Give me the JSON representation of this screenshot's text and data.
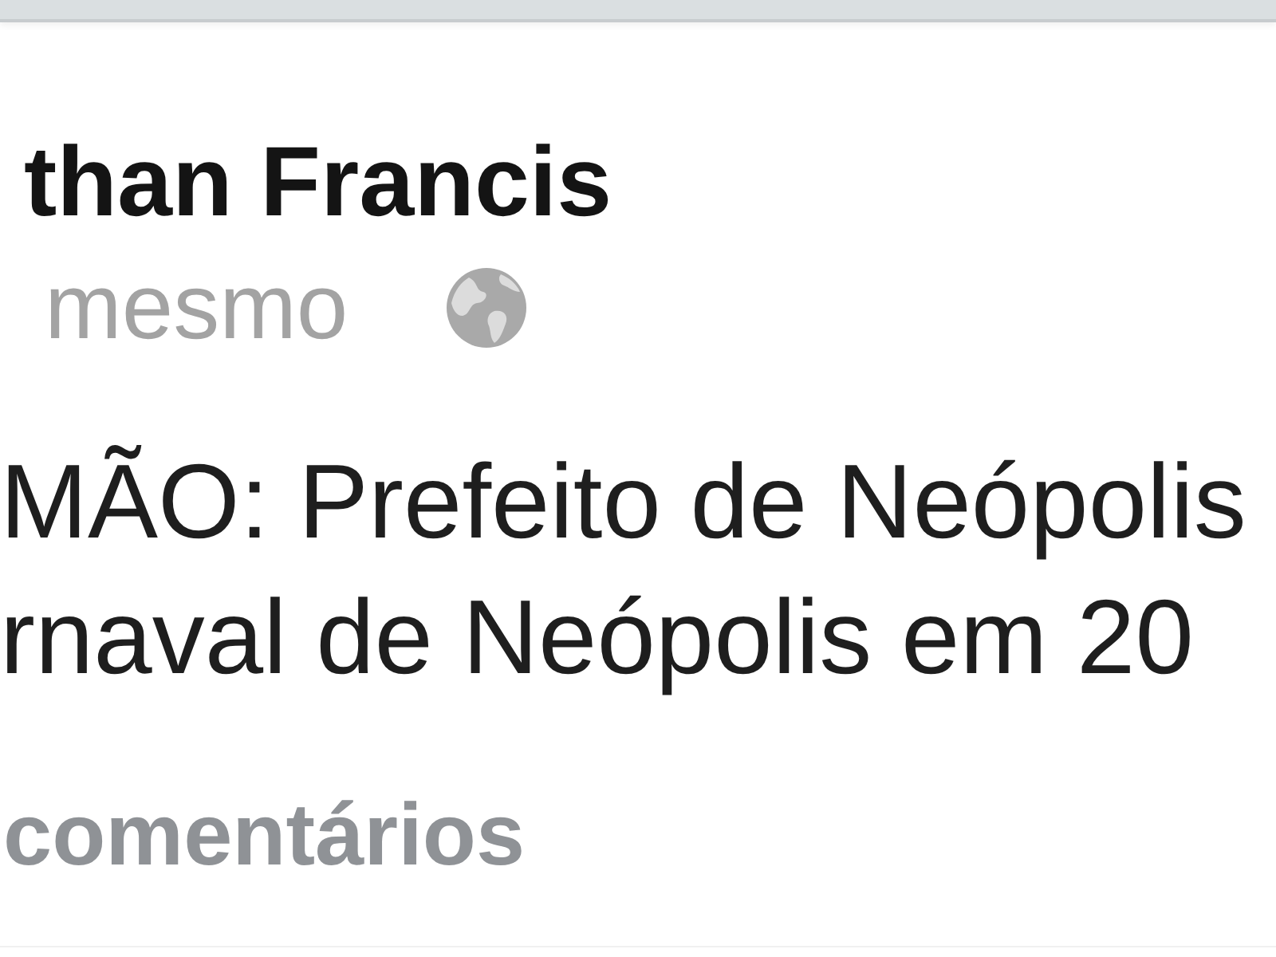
{
  "post": {
    "author": "than Francis",
    "timestamp": "mesmo",
    "text_lines": [
      "MÃO: Prefeito de Neópolis",
      "rnaval de Neópolis em 20"
    ],
    "comments_link": "comentários"
  }
}
